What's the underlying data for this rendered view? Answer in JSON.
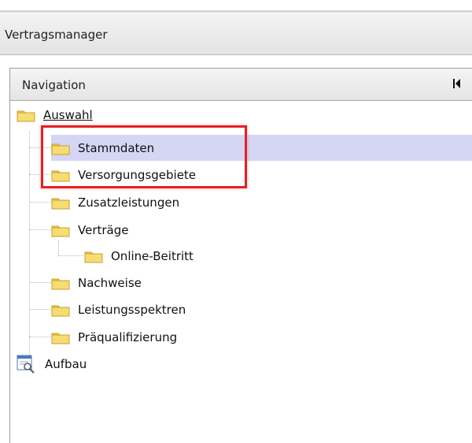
{
  "app": {
    "title": "Vertragsmanager"
  },
  "navigation": {
    "title": "Navigation",
    "collapse_icon": "collapse-left-icon"
  },
  "tree": {
    "root": {
      "label": "Auswahl",
      "icon": "folder-icon"
    },
    "children": [
      {
        "label": "Stammdaten",
        "icon": "folder-icon",
        "selected": true
      },
      {
        "label": "Versorgungsgebiete",
        "icon": "folder-icon",
        "selected": false
      },
      {
        "label": "Zusatzleistungen",
        "icon": "folder-icon",
        "selected": false
      },
      {
        "label": "Verträge",
        "icon": "folder-icon",
        "selected": false,
        "children": [
          {
            "label": "Online-Beitritt",
            "icon": "folder-icon"
          }
        ]
      },
      {
        "label": "Nachweise",
        "icon": "folder-icon",
        "selected": false
      },
      {
        "label": "Leistungsspektren",
        "icon": "folder-icon",
        "selected": false
      },
      {
        "label": "Präqualifizierung",
        "icon": "folder-icon",
        "selected": false
      }
    ],
    "second_root": {
      "label": "Aufbau",
      "icon": "document-search-icon"
    }
  },
  "colors": {
    "selection": "#d4d6f4",
    "highlight": "#e62025",
    "folder": "#f2cf55"
  }
}
